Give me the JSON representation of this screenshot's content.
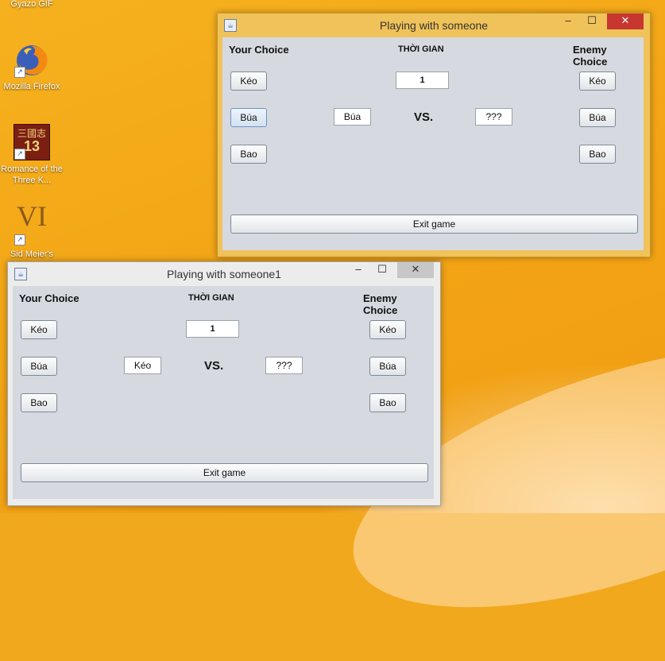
{
  "desktop": {
    "icons": [
      {
        "name": "gyazo-gif",
        "label": "Gyazo GIF"
      },
      {
        "name": "mozilla-firefox",
        "label": "Mozilla Firefox"
      },
      {
        "name": "romance-three-kingdoms",
        "label": "Romance of the Three K...",
        "glyph": "13"
      },
      {
        "name": "sid-meiers-civ",
        "label": "Sid Meier's",
        "glyph": "VI"
      }
    ]
  },
  "window1": {
    "title": "Playing with someone",
    "your_choice_label": "Your Choice",
    "timer_label": "THỜI GIAN",
    "enemy_choice_label": "Enemy Choice",
    "timer_value": "1",
    "your_choices": [
      "Kéo",
      "Búa",
      "Bao"
    ],
    "enemy_choices": [
      "Kéo",
      "Búa",
      "Bao"
    ],
    "player_selection": "Búa",
    "vs_label": "VS.",
    "enemy_selection": "???",
    "exit_label": "Exit game"
  },
  "window2": {
    "title": "Playing with someone1",
    "your_choice_label": "Your Choice",
    "timer_label": "THỜI GIAN",
    "enemy_choice_label": "Enemy Choice",
    "timer_value": "1",
    "your_choices": [
      "Kéo",
      "Búa",
      "Bao"
    ],
    "enemy_choices": [
      "Kéo",
      "Búa",
      "Bao"
    ],
    "player_selection": "Kéo",
    "vs_label": "VS.",
    "enemy_selection": "???",
    "exit_label": "Exit game"
  },
  "window_controls": {
    "minimize": "–",
    "maximize": "☐",
    "close": "✕"
  },
  "colors": {
    "desktop": "#f3a616",
    "active_title": "#f0c25a",
    "close_button": "#c7372f",
    "panel": "#d6d9df"
  }
}
